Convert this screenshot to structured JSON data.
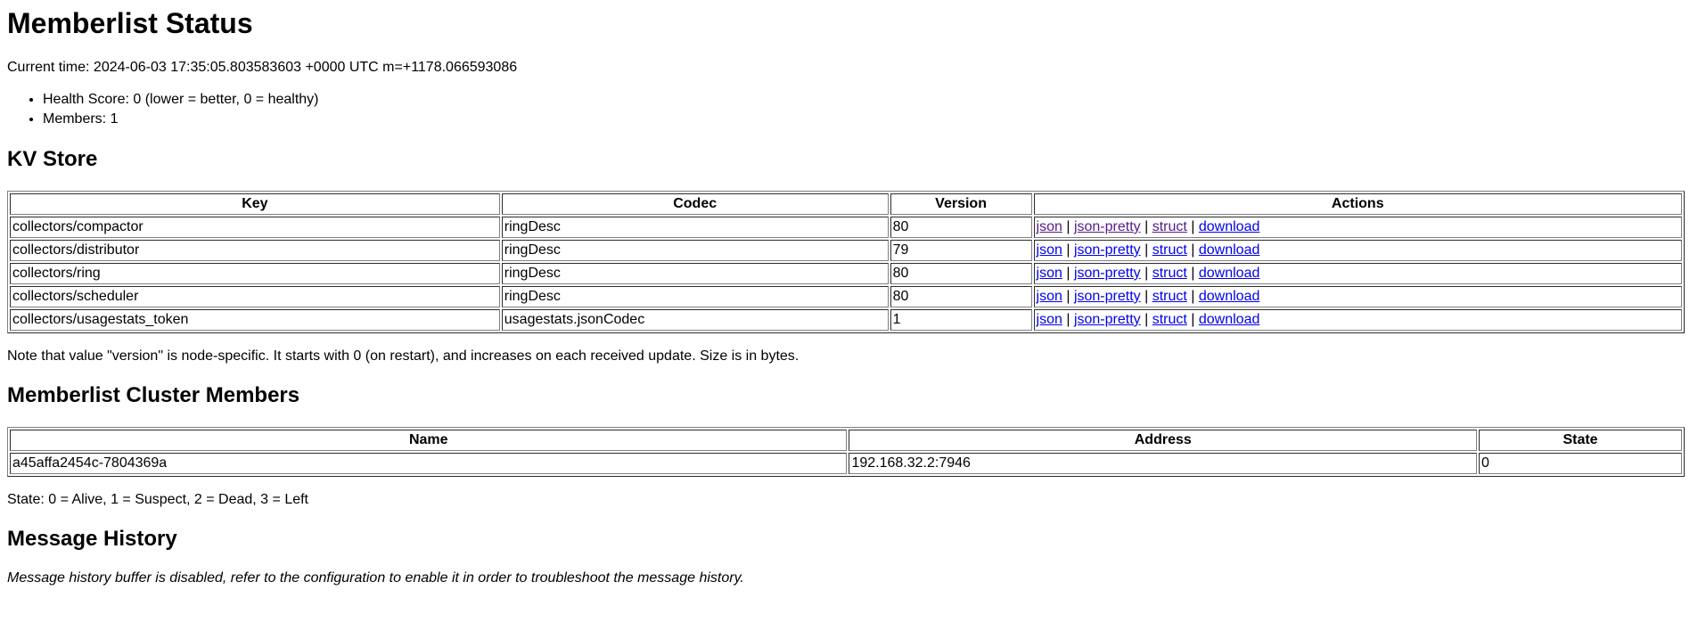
{
  "page": {
    "title": "Memberlist Status",
    "current_time_line": "Current time: 2024-06-03 17:35:05.803583603 +0000 UTC m=+1178.066593086",
    "summary_items": [
      "Health Score: 0 (lower = better, 0 = healthy)",
      "Members: 1"
    ]
  },
  "kv_store": {
    "heading": "KV Store",
    "columns": [
      "Key",
      "Codec",
      "Version",
      "Actions"
    ],
    "rows": [
      {
        "key": "collectors/compactor",
        "codec": "ringDesc",
        "version": "80",
        "actions": [
          "json",
          "json-pretty",
          "struct",
          "download"
        ],
        "visited": [
          true,
          true,
          true,
          false
        ]
      },
      {
        "key": "collectors/distributor",
        "codec": "ringDesc",
        "version": "79",
        "actions": [
          "json",
          "json-pretty",
          "struct",
          "download"
        ],
        "visited": [
          false,
          false,
          false,
          false
        ]
      },
      {
        "key": "collectors/ring",
        "codec": "ringDesc",
        "version": "80",
        "actions": [
          "json",
          "json-pretty",
          "struct",
          "download"
        ],
        "visited": [
          false,
          false,
          false,
          false
        ]
      },
      {
        "key": "collectors/scheduler",
        "codec": "ringDesc",
        "version": "80",
        "actions": [
          "json",
          "json-pretty",
          "struct",
          "download"
        ],
        "visited": [
          false,
          false,
          false,
          false
        ]
      },
      {
        "key": "collectors/usagestats_token",
        "codec": "usagestats.jsonCodec",
        "version": "1",
        "actions": [
          "json",
          "json-pretty",
          "struct",
          "download"
        ],
        "visited": [
          false,
          false,
          false,
          false
        ]
      }
    ],
    "action_separator": "|",
    "note": "Note that value \"version\" is node-specific. It starts with 0 (on restart), and increases on each received update. Size is in bytes."
  },
  "cluster_members": {
    "heading": "Memberlist Cluster Members",
    "columns": [
      "Name",
      "Address",
      "State"
    ],
    "rows": [
      {
        "name": "a45affa2454c-7804369a",
        "address": "192.168.32.2:7946",
        "state": "0"
      }
    ],
    "state_legend": "State: 0 = Alive, 1 = Suspect, 2 = Dead, 3 = Left"
  },
  "message_history": {
    "heading": "Message History",
    "disabled_notice": "Message history buffer is disabled, refer to the configuration to enable it in order to troubleshoot the message history."
  },
  "colors": {
    "link": "#0000EE",
    "visited_link": "#551A8B",
    "text": "#000000",
    "background": "#FFFFFF",
    "table_border": "#808080"
  }
}
